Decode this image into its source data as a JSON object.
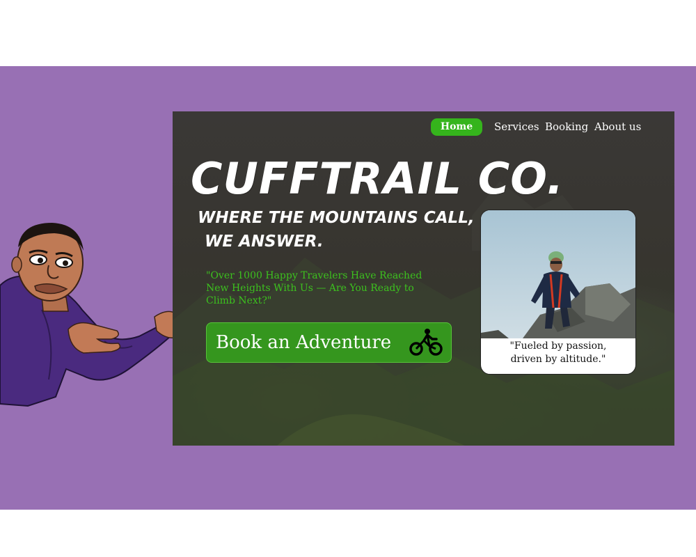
{
  "nav": {
    "home": "Home",
    "services": "Services",
    "booking": "Booking",
    "about": "About us"
  },
  "hero": {
    "brand": "CUFFTRAIL CO.",
    "tagline_line1": "WHERE THE MOUNTAINS CALL,",
    "tagline_line2": "WE ANSWER.",
    "quote": "\"Over 1000 Happy Travelers Have Reached New Heights With Us — Are You Ready to Climb Next?\"",
    "cta_label": "Book an Adventure",
    "cta_icon": "bicycle-rider-icon"
  },
  "card": {
    "caption_line1": "\"Fueled by passion,",
    "caption_line2": "driven by altitude.\""
  },
  "colors": {
    "accent_green": "#35b41c",
    "quote_green": "#3cc11e",
    "purple_background": "#9870b4"
  }
}
